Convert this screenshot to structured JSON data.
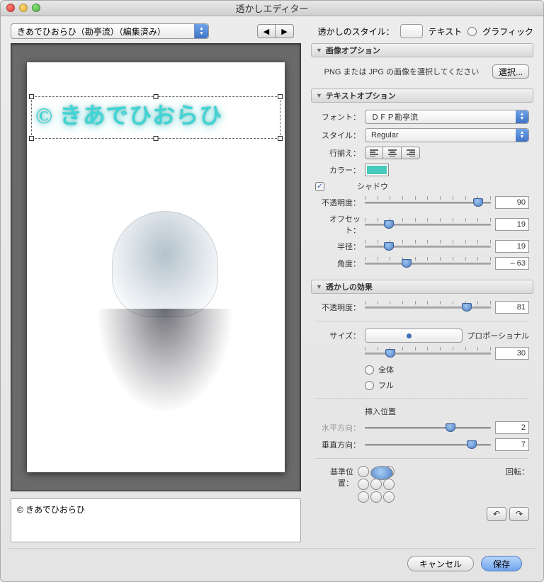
{
  "window": {
    "title": "透かしエディター"
  },
  "preset": {
    "label": "きあでひおらひ（勘亭流）（編集済み）"
  },
  "styleRow": {
    "label": "透かしのスタイル：",
    "text": "テキスト",
    "graphic": "グラフィック"
  },
  "imageOptions": {
    "header": "画像オプション",
    "hint": "PNG または JPG の画像を選択してください",
    "chooseBtn": "選択..."
  },
  "textOptions": {
    "header": "テキストオプション",
    "fontLabel": "フォント：",
    "fontValue": "ＤＦＰ勘亭流",
    "styleLabel": "スタイル：",
    "styleValue": "Regular",
    "alignLabel": "行揃え：",
    "colorLabel": "カラー：",
    "shadowLabel": "シャドウ",
    "opacityLabel": "不透明度：",
    "opacityValue": "90",
    "offsetLabel": "オフセット：",
    "offsetValue": "19",
    "radiusLabel": "半径：",
    "radiusValue": "19",
    "angleLabel": "角度：",
    "angleValue": "– 63"
  },
  "effects": {
    "header": "透かしの効果",
    "opacityLabel": "不透明度：",
    "opacityValue": "81",
    "sizeLabel": "サイズ：",
    "sizeProportional": "プロポーショナル",
    "sizeProportionalValue": "30",
    "sizeFit": "全体",
    "sizeFill": "フル",
    "insetHeader": "挿入位置",
    "hLabel": "水平方向：",
    "hValue": "2",
    "vLabel": "垂直方向：",
    "vValue": "7",
    "anchorLabel": "基準位置：",
    "rotateLabel": "回転："
  },
  "watermarkText": "© きあでひおらひ",
  "textarea": "© きあでひおらひ",
  "buttons": {
    "cancel": "キャンセル",
    "save": "保存"
  }
}
